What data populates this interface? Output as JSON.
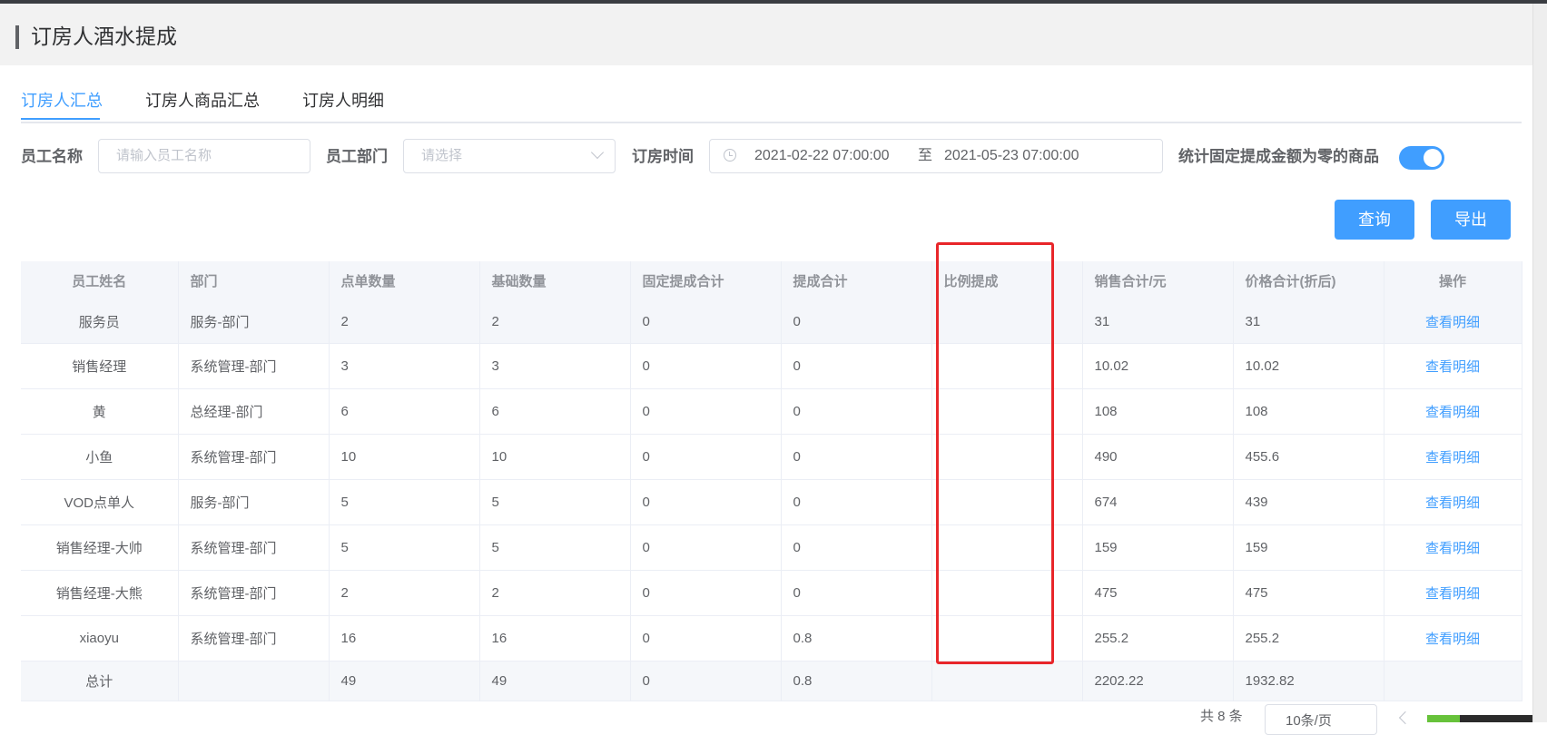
{
  "page": {
    "title": "订房人酒水提成"
  },
  "tabs": [
    {
      "label": "订房人汇总",
      "active": true
    },
    {
      "label": "订房人商品汇总",
      "active": false
    },
    {
      "label": "订房人明细",
      "active": false
    }
  ],
  "filters": {
    "employee_name_label": "员工名称",
    "employee_name_placeholder": "请输入员工名称",
    "department_label": "员工部门",
    "department_placeholder": "请选择",
    "booking_time_label": "订房时间",
    "start_time": "2021-02-22 07:00:00",
    "range_separator": "至",
    "end_time": "2021-05-23 07:00:00",
    "zero_commission_label": "统计固定提成金额为零的商品",
    "zero_commission_enabled": true
  },
  "actions": {
    "query_label": "查询",
    "export_label": "导出"
  },
  "table": {
    "headers": [
      "员工姓名",
      "部门",
      "点单数量",
      "基础数量",
      "固定提成合计",
      "提成合计",
      "比例提成",
      "销售合计/元",
      "价格合计(折后)",
      "操作"
    ],
    "rows": [
      {
        "name": "服务员",
        "dept": "服务-部门",
        "orders": "2",
        "base": "2",
        "fixed": "0",
        "total": "0",
        "ratio": "",
        "sales": "31",
        "price": "31",
        "action": "查看明细"
      },
      {
        "name": "销售经理",
        "dept": "系统管理-部门",
        "orders": "3",
        "base": "3",
        "fixed": "0",
        "total": "0",
        "ratio": "",
        "sales": "10.02",
        "price": "10.02",
        "action": "查看明细"
      },
      {
        "name": "黄",
        "dept": "总经理-部门",
        "orders": "6",
        "base": "6",
        "fixed": "0",
        "total": "0",
        "ratio": "",
        "sales": "108",
        "price": "108",
        "action": "查看明细"
      },
      {
        "name": "小鱼",
        "dept": "系统管理-部门",
        "orders": "10",
        "base": "10",
        "fixed": "0",
        "total": "0",
        "ratio": "",
        "sales": "490",
        "price": "455.6",
        "action": "查看明细"
      },
      {
        "name": "VOD点单人",
        "dept": "服务-部门",
        "orders": "5",
        "base": "5",
        "fixed": "0",
        "total": "0",
        "ratio": "",
        "sales": "674",
        "price": "439",
        "action": "查看明细"
      },
      {
        "name": "销售经理-大帅",
        "dept": "系统管理-部门",
        "orders": "5",
        "base": "5",
        "fixed": "0",
        "total": "0",
        "ratio": "",
        "sales": "159",
        "price": "159",
        "action": "查看明细"
      },
      {
        "name": "销售经理-大熊",
        "dept": "系统管理-部门",
        "orders": "2",
        "base": "2",
        "fixed": "0",
        "total": "0",
        "ratio": "",
        "sales": "475",
        "price": "475",
        "action": "查看明细"
      },
      {
        "name": "xiaoyu",
        "dept": "系统管理-部门",
        "orders": "16",
        "base": "16",
        "fixed": "0",
        "total": "0.8",
        "ratio": "",
        "sales": "255.2",
        "price": "255.2",
        "action": "查看明细"
      }
    ],
    "summary": {
      "label": "总计",
      "dept": "",
      "orders": "49",
      "base": "49",
      "fixed": "0",
      "total": "0.8",
      "ratio": "",
      "sales": "2202.22",
      "price": "1932.82",
      "action": ""
    }
  },
  "pagination": {
    "total_text": "共 8 条",
    "page_size_text": "10条/页"
  },
  "colors": {
    "accent": "#409eff",
    "annotation": "#e8262a"
  }
}
